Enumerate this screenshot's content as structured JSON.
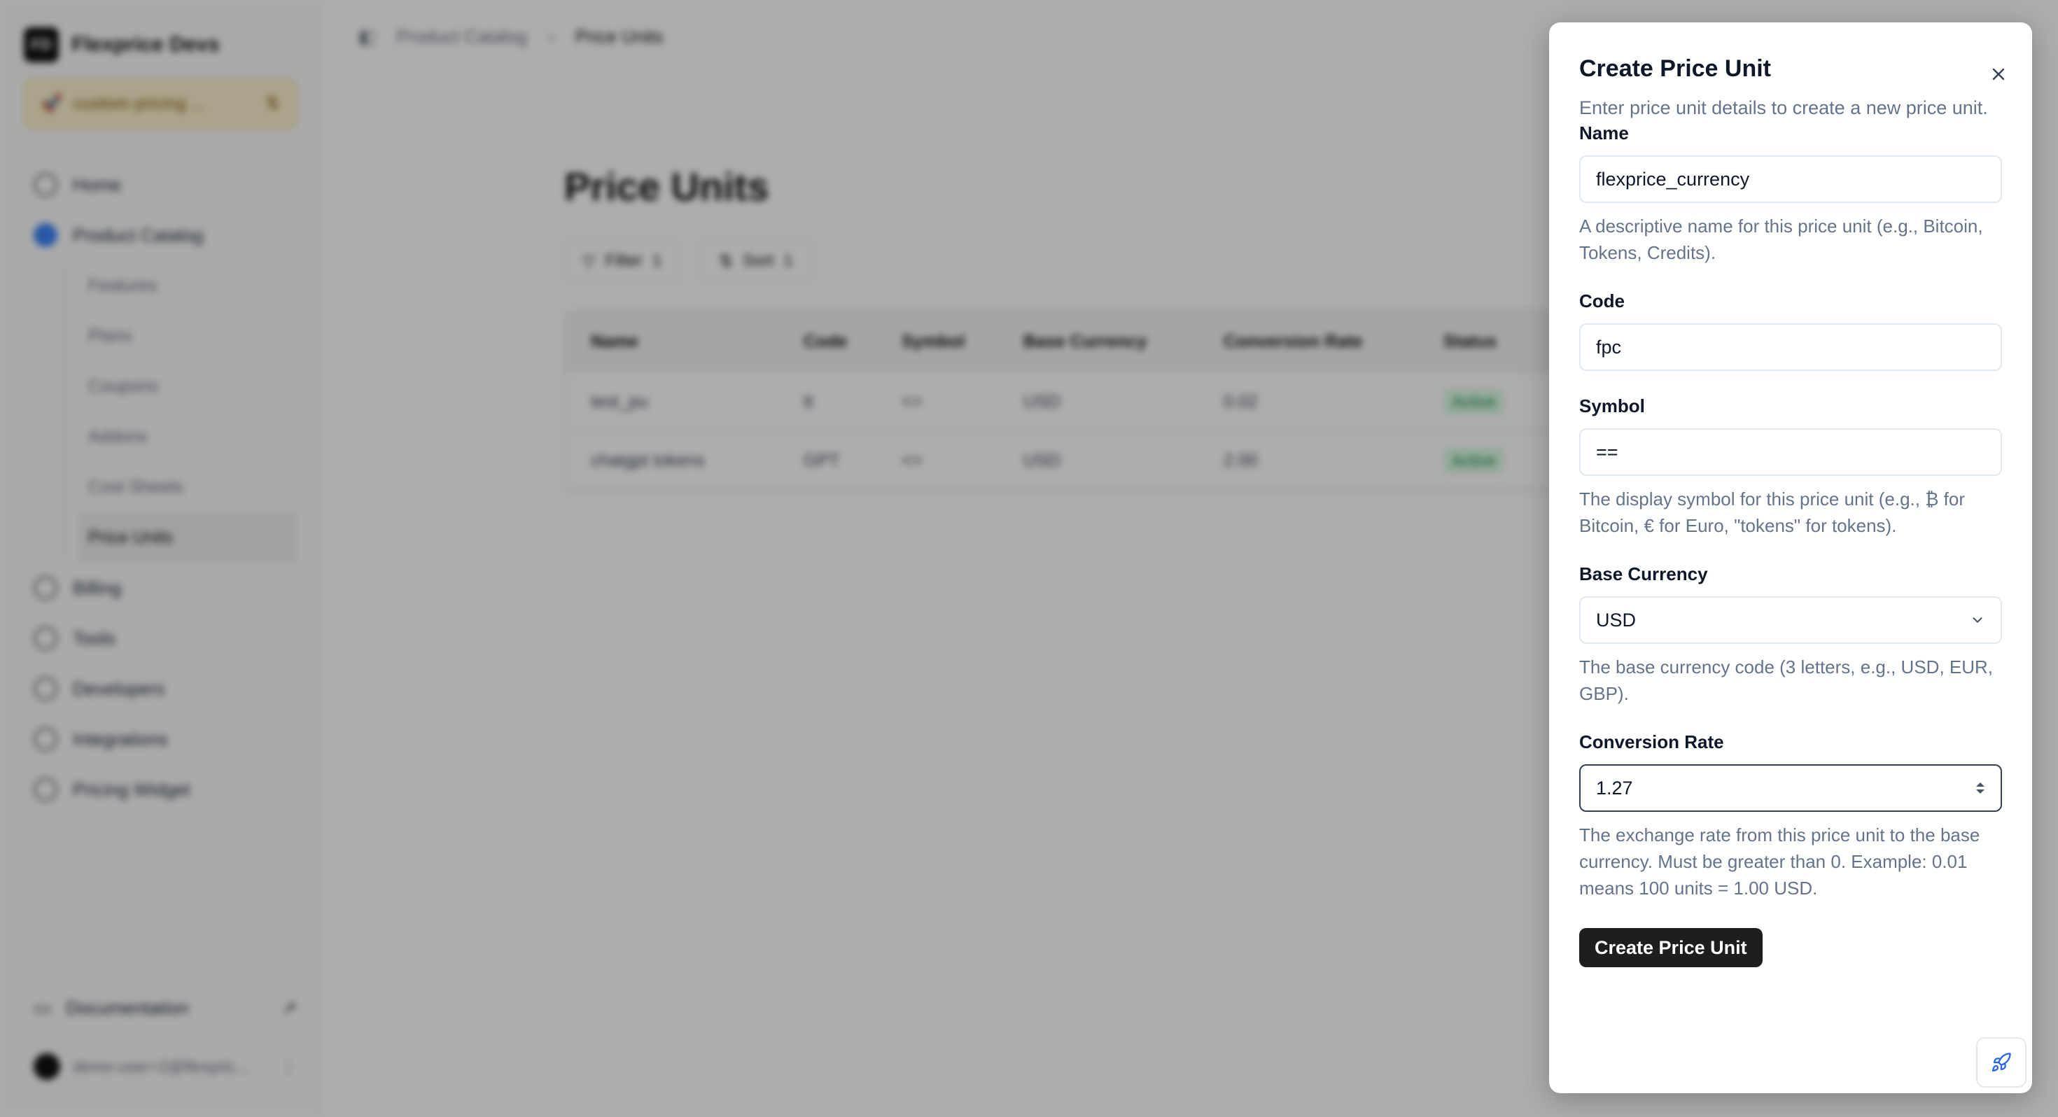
{
  "sidebar": {
    "brand_initials": "FD",
    "brand_name": "Flexprice Devs",
    "environment": "custom pricing ...",
    "items": [
      {
        "label": "Home"
      },
      {
        "label": "Product Catalog"
      }
    ],
    "subitems": [
      {
        "label": "Features"
      },
      {
        "label": "Plans"
      },
      {
        "label": "Coupons"
      },
      {
        "label": "Addons"
      },
      {
        "label": "Cost Sheets"
      },
      {
        "label": "Price Units"
      }
    ],
    "lower_items": [
      {
        "label": "Billing"
      },
      {
        "label": "Tools"
      },
      {
        "label": "Developers"
      },
      {
        "label": "Integrations"
      },
      {
        "label": "Pricing Widget"
      }
    ],
    "documentation": "Documentation",
    "user_email": "demo-user+2@flexpric..."
  },
  "topbar": {
    "breadcrumb_parent": "Product Catalog",
    "breadcrumb_current": "Price Units"
  },
  "main": {
    "title": "Price Units",
    "filter_label": "Filter",
    "filter_count": "1",
    "sort_label": "Sort",
    "sort_count": "1",
    "table": {
      "headers": [
        "Name",
        "Code",
        "Symbol",
        "Base Currency",
        "Conversion Rate",
        "Status"
      ],
      "rows": [
        [
          "test_pu",
          "tt",
          "<>",
          "USD",
          "0.02",
          "Active"
        ],
        [
          "chatgpt tokens",
          "GPT",
          "<>",
          "USD",
          "2.00",
          "Active"
        ]
      ]
    }
  },
  "dialog": {
    "title": "Create Price Unit",
    "description": "Enter price unit details to create a new price unit.",
    "name_label": "Name",
    "name_value": "flexprice_currency",
    "name_hint": "A descriptive name for this price unit (e.g., Bitcoin, Tokens, Credits).",
    "code_label": "Code",
    "code_value": "fpc",
    "symbol_label": "Symbol",
    "symbol_value": "==",
    "symbol_hint": "The display symbol for this price unit (e.g., ₿ for Bitcoin, € for Euro, \"tokens\" for tokens).",
    "base_currency_label": "Base Currency",
    "base_currency_value": "USD",
    "base_currency_hint": "The base currency code (3 letters, e.g., USD, EUR, GBP).",
    "conversion_rate_label": "Conversion Rate",
    "conversion_rate_value": "1.27",
    "conversion_rate_hint": "The exchange rate from this price unit to the base currency. Must be greater than 0. Example: 0.01 means 100 units = 1.00 USD.",
    "submit_label": "Create Price Unit"
  }
}
